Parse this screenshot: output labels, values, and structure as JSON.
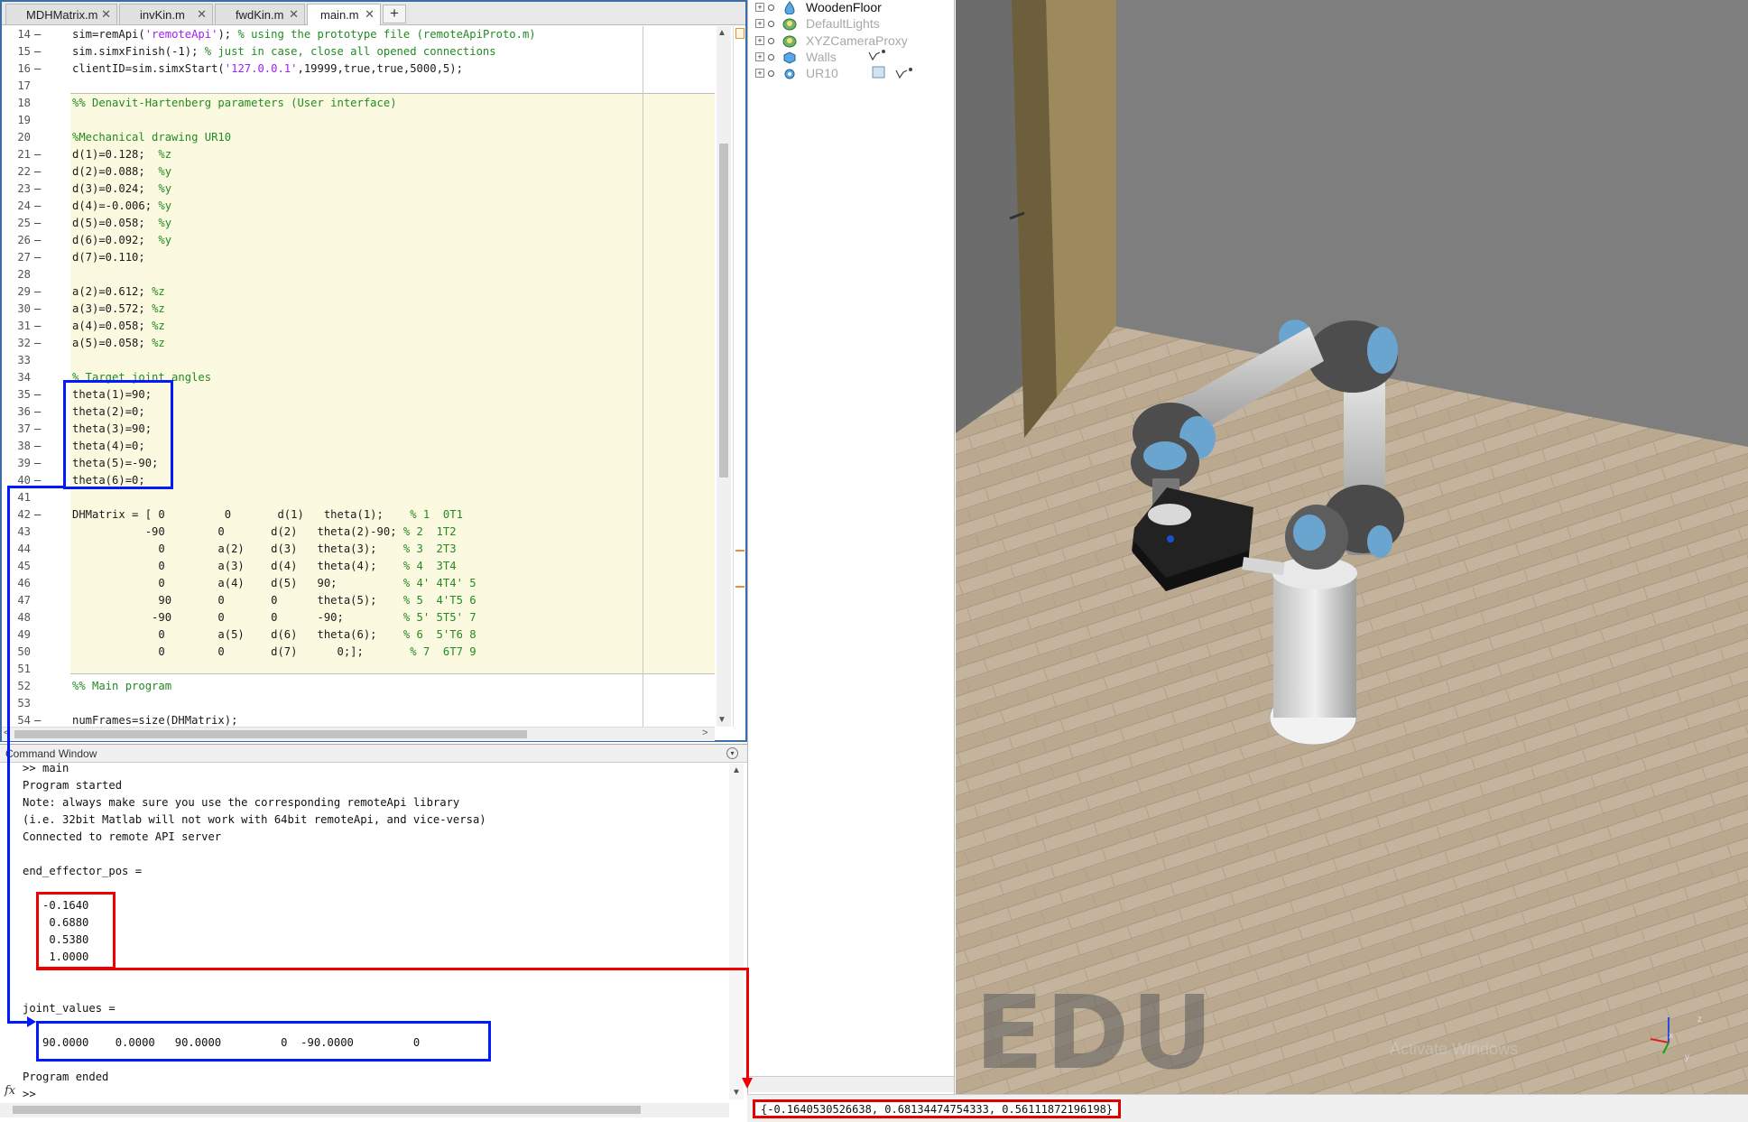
{
  "tabs": [
    {
      "label": "MDHMatrix.m",
      "close": "✕"
    },
    {
      "label": "invKin.m",
      "close": "✕"
    },
    {
      "label": "fwdKin.m",
      "close": "✕"
    },
    {
      "label": "main.m",
      "close": "✕"
    }
  ],
  "tab_add": "+",
  "editor": {
    "lines": [
      {
        "n": "14",
        "d": "–",
        "code": "sim=remApi(",
        "str": "'remoteApi'",
        "rest": "); ",
        "cmt": "% using the prototype file (remoteApiProto.m)"
      },
      {
        "n": "15",
        "d": "–",
        "code": "sim.simxFinish(-1); ",
        "cmt": "% just in case, close all opened connections"
      },
      {
        "n": "16",
        "d": "–",
        "code": "clientID=sim.simxStart(",
        "str": "'127.0.0.1'",
        "rest": ",19999,true,true,5000,5);"
      },
      {
        "n": "17",
        "d": "",
        "code": ""
      },
      {
        "n": "18",
        "d": "",
        "cmt": "%% Denavit-Hartenberg parameters (User interface)"
      },
      {
        "n": "19",
        "d": "",
        "code": ""
      },
      {
        "n": "20",
        "d": "",
        "cmt": "%Mechanical drawing UR10"
      },
      {
        "n": "21",
        "d": "–",
        "code": "d(1)=0.128;  ",
        "cmt": "%z"
      },
      {
        "n": "22",
        "d": "–",
        "code": "d(2)=0.088;  ",
        "cmt": "%y"
      },
      {
        "n": "23",
        "d": "–",
        "code": "d(3)=0.024;  ",
        "cmt": "%y"
      },
      {
        "n": "24",
        "d": "–",
        "code": "d(4)=-0.006; ",
        "cmt": "%y"
      },
      {
        "n": "25",
        "d": "–",
        "code": "d(5)=0.058;  ",
        "cmt": "%y"
      },
      {
        "n": "26",
        "d": "–",
        "code": "d(6)=0.092;  ",
        "cmt": "%y"
      },
      {
        "n": "27",
        "d": "–",
        "code": "d(7)=0.110;"
      },
      {
        "n": "28",
        "d": "",
        "code": ""
      },
      {
        "n": "29",
        "d": "–",
        "code": "a(2)=0.612; ",
        "cmt": "%z"
      },
      {
        "n": "30",
        "d": "–",
        "code": "a(3)=0.572; ",
        "cmt": "%z"
      },
      {
        "n": "31",
        "d": "–",
        "code": "a(4)=0.058; ",
        "cmt": "%z"
      },
      {
        "n": "32",
        "d": "–",
        "code": "a(5)=0.058; ",
        "cmt": "%z"
      },
      {
        "n": "33",
        "d": "",
        "code": ""
      },
      {
        "n": "34",
        "d": "",
        "cmt": "% Target joint angles"
      },
      {
        "n": "35",
        "d": "–",
        "code": "theta(1)=90;"
      },
      {
        "n": "36",
        "d": "–",
        "code": "theta(2)=0;"
      },
      {
        "n": "37",
        "d": "–",
        "code": "theta(3)=90;"
      },
      {
        "n": "38",
        "d": "–",
        "code": "theta(4)=0;"
      },
      {
        "n": "39",
        "d": "–",
        "code": "theta(5)=-90;"
      },
      {
        "n": "40",
        "d": "–",
        "code": "theta(6)=0;"
      },
      {
        "n": "41",
        "d": "",
        "code": ""
      },
      {
        "n": "42",
        "d": "–",
        "code": "DHMatrix = [ 0         0       d(1)   theta(1);    ",
        "cmt": "% 1  0T1"
      },
      {
        "n": "43",
        "d": "",
        "code": "           -90        0       d(2)   theta(2)-90; ",
        "cmt": "% 2  1T2"
      },
      {
        "n": "44",
        "d": "",
        "code": "             0        a(2)    d(3)   theta(3);    ",
        "cmt": "% 3  2T3"
      },
      {
        "n": "45",
        "d": "",
        "code": "             0        a(3)    d(4)   theta(4);    ",
        "cmt": "% 4  3T4"
      },
      {
        "n": "46",
        "d": "",
        "code": "             0        a(4)    d(5)   90;          ",
        "cmt": "% 4' 4T4' 5"
      },
      {
        "n": "47",
        "d": "",
        "code": "             90       0       0      theta(5);    ",
        "cmt": "% 5  4'T5 6"
      },
      {
        "n": "48",
        "d": "",
        "code": "            -90       0       0      -90;         ",
        "cmt": "% 5' 5T5' 7"
      },
      {
        "n": "49",
        "d": "",
        "code": "             0        a(5)    d(6)   theta(6);    ",
        "cmt": "% 6  5'T6 8"
      },
      {
        "n": "50",
        "d": "",
        "code": "             0        0       d(7)      0;];       ",
        "cmt": "% 7  6T7 9"
      },
      {
        "n": "51",
        "d": "",
        "code": ""
      },
      {
        "n": "52",
        "d": "",
        "cmt": "%% Main program"
      },
      {
        "n": "53",
        "d": "",
        "code": ""
      },
      {
        "n": "54",
        "d": "–",
        "code": "numFrames=size(DHMatrix);"
      }
    ]
  },
  "scroll_arrows": {
    "up": "▲",
    "down": "▼",
    "left": "<",
    "right": ">"
  },
  "command_window": {
    "title": "Command Window",
    "menu_icon": "▾",
    "lines": [
      ">> main",
      "Program started",
      "Note: always make sure you use the corresponding remoteApi library",
      "(i.e. 32bit Matlab will not work with 64bit remoteApi, and vice-versa)",
      "Connected to remote API server",
      "",
      "end_effector_pos =",
      "",
      "   -0.1640",
      "    0.6880",
      "    0.5380",
      "    1.0000",
      "",
      "",
      "joint_values =",
      "",
      "   90.0000    0.0000   90.0000         0  -90.0000         0",
      "",
      "Program ended",
      ">>"
    ],
    "fx": "fx"
  },
  "hierarchy": {
    "items": [
      {
        "label": "WoodenFloor",
        "color": "#111111",
        "expander": "+"
      },
      {
        "label": "DefaultLights",
        "color": "#a8a8a8",
        "expander": "+"
      },
      {
        "label": "XYZCameraProxy",
        "color": "#a8a8a8",
        "expander": "+"
      },
      {
        "label": "Walls",
        "color": "#a8a8a8",
        "expander": "+"
      },
      {
        "label": "UR10",
        "color": "#a8a8a8",
        "expander": "+"
      }
    ]
  },
  "viewport": {
    "watermark": "EDU",
    "activate_hint": "Activate Windows",
    "axes": {
      "z": "z",
      "x": "x",
      "y": "y"
    }
  },
  "status": {
    "position_readout": "{-0.1640530526638, 0.68134474754333, 0.56111872196198}"
  },
  "colors": {
    "highlight_blue": "#0019ff",
    "highlight_red": "#ee0000",
    "comment_green": "#228b22",
    "string_purple": "#a020f0",
    "cell_bg": "#fbf9e0"
  }
}
